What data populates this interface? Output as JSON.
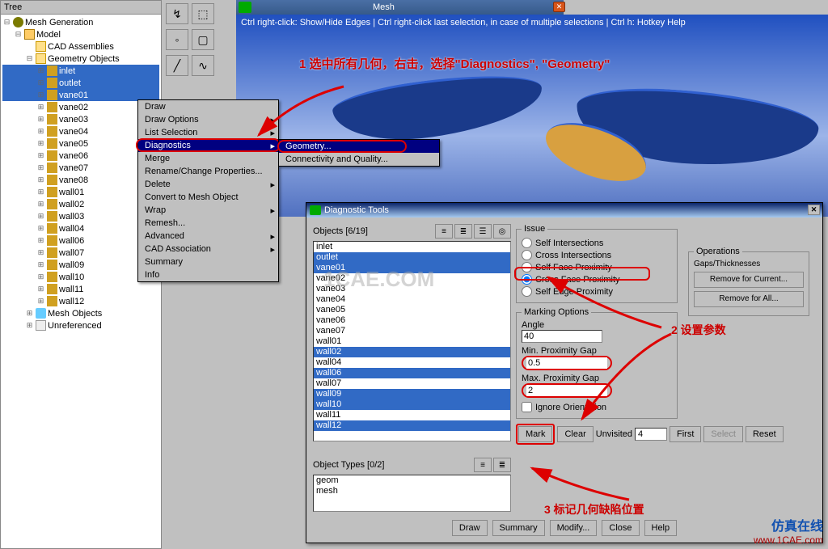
{
  "tree": {
    "title": "Tree",
    "root": "Mesh Generation",
    "model": "Model",
    "cad": "CAD Assemblies",
    "geom": "Geometry Objects",
    "items": [
      "inlet",
      "outlet",
      "vane01",
      "vane02",
      "vane03",
      "vane04",
      "vane05",
      "vane06",
      "vane07",
      "vane08",
      "wall01",
      "wall02",
      "wall03",
      "wall04",
      "wall06",
      "wall07",
      "wall09",
      "wall10",
      "wall11",
      "wall12"
    ],
    "meshobj": "Mesh Objects",
    "unref": "Unreferenced"
  },
  "mesh_title": "Mesh",
  "viewport_hint": "Ctrl right-click: Show/Hide Edges | Ctrl right-click last selection, in case of multiple selections | Ctrl h: Hotkey Help",
  "annotation1": "1 选中所有几何，右击，选择\"Diagnostics\", \"Geometry\"",
  "annotation2": "2 设置参数",
  "annotation3": "3 标记几何缺陷位置",
  "ctx": {
    "items": [
      "Draw",
      "Draw Options",
      "List Selection",
      "Diagnostics",
      "Merge",
      "Rename/Change Properties...",
      "Delete",
      "Convert to Mesh Object",
      "Wrap",
      "Remesh...",
      "Advanced",
      "CAD Association",
      "Summary",
      "Info"
    ],
    "arrows": [
      false,
      true,
      true,
      true,
      false,
      false,
      true,
      false,
      true,
      false,
      true,
      true,
      false,
      false
    ],
    "sub": [
      "Geometry...",
      "Connectivity and Quality..."
    ]
  },
  "dialog": {
    "title": "Diagnostic Tools",
    "objects_label": "Objects [6/19]",
    "list": [
      "inlet",
      "outlet",
      "vane01",
      "vane02",
      "vane03",
      "vane04",
      "vane05",
      "vane06",
      "vane07",
      "wall01",
      "wall02",
      "wall04",
      "wall06",
      "wall07",
      "wall09",
      "wall10",
      "wall11",
      "wall12"
    ],
    "sel_idx": [
      1,
      2,
      10,
      12,
      14,
      15,
      17
    ],
    "objtypes_label": "Object Types [0/2]",
    "objtypes": [
      "geom",
      "mesh"
    ],
    "issue": {
      "legend": "Issue",
      "opts": [
        "Self Intersections",
        "Cross Intersections",
        "Self Face Proximity",
        "Cross Face Proximity",
        "Self Edge Proximity"
      ],
      "selected": 3
    },
    "ops": {
      "legend": "Operations",
      "gaps": "Gaps/Thicknesses",
      "b1": "Remove for Current...",
      "b2": "Remove for All..."
    },
    "marking": {
      "legend": "Marking Options",
      "angle_label": "Angle",
      "angle": "40",
      "min_label": "Min. Proximity Gap",
      "min": "0.5",
      "max_label": "Max. Proximity Gap",
      "max": "2",
      "ignore": "Ignore Orientation"
    },
    "buttons": {
      "mark": "Mark",
      "clear": "Clear",
      "unvisited": "Unvisited",
      "unv_val": "4",
      "first": "First",
      "select": "Select",
      "reset": "Reset"
    },
    "bottom": [
      "Draw",
      "Summary",
      "Modify...",
      "Close",
      "Help"
    ]
  },
  "logo": {
    "cn": "仿真在线",
    "en": "www.1CAE.com"
  }
}
